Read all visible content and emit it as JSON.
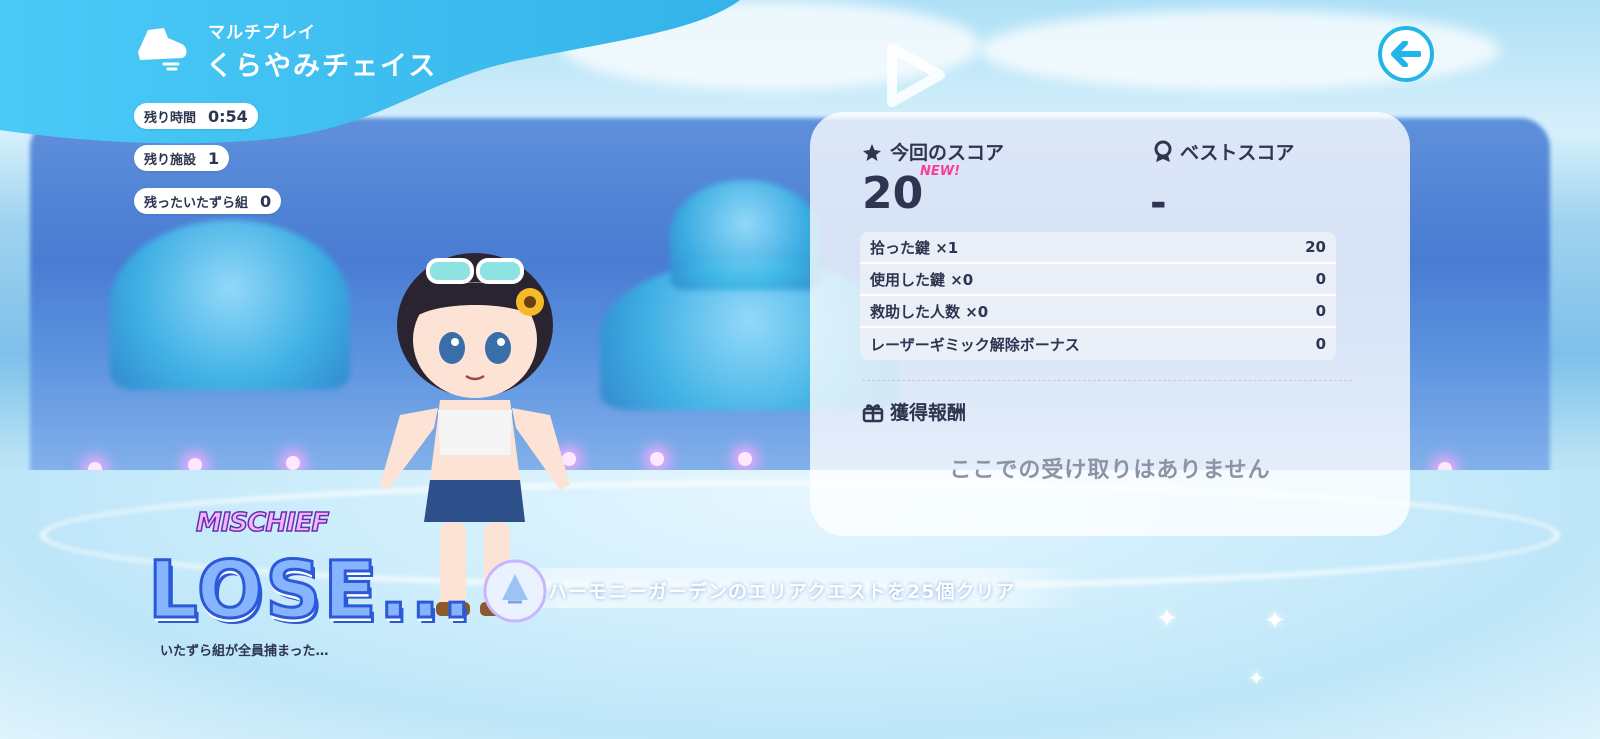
{
  "header": {
    "mode_subtitle": "マルチプレイ",
    "mode_title": "くらやみチェイス"
  },
  "stats": [
    {
      "label": "残り時間",
      "value": "0:54"
    },
    {
      "label": "残り施設",
      "value": "1"
    },
    {
      "label": "残ったいたずら組",
      "value": "0"
    }
  ],
  "score_panel": {
    "current_label": "今回のスコア",
    "current_value": "20",
    "new_badge": "NEW!",
    "best_label": "ベストスコア",
    "best_value": "-",
    "breakdown": [
      {
        "label": "拾った鍵 ×1",
        "value": "20"
      },
      {
        "label": "使用した鍵 ×0",
        "value": "0"
      },
      {
        "label": "救助した人数 ×0",
        "value": "0"
      },
      {
        "label": "レーザーギミック解除ボーナス",
        "value": "0"
      }
    ],
    "reward_label": "獲得報酬",
    "reward_empty": "ここでの受け取りはありません"
  },
  "result": {
    "team": "MISCHIEF",
    "outcome": "LOSE...",
    "message": "いたずら組が全員捕まった…"
  },
  "achievement": {
    "text": "ハーモニーガーデンのエリアクエストを25個クリア"
  },
  "colors": {
    "accent": "#22b6e8",
    "text_dark": "#2d3550",
    "new_badge": "#ff3c9e",
    "lose_fill": "#86b4ff",
    "lose_stroke": "#2b59d8"
  }
}
